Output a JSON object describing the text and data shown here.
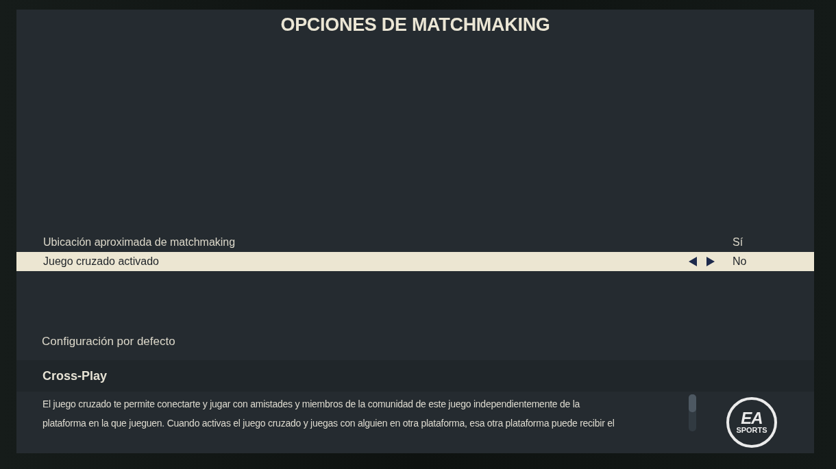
{
  "title": "OPCIONES DE MATCHMAKING",
  "settings": [
    {
      "label": "Ubicación aproximada de matchmaking",
      "value": "Sí",
      "selected": false
    },
    {
      "label": "Juego cruzado activado",
      "value": "No",
      "selected": true
    }
  ],
  "reset_button": {
    "label": "Configuración por defecto"
  },
  "help": {
    "title": "Cross-Play",
    "lines": [
      "El juego cruzado te permite conectarte y jugar con amistades y miembros de la comunidad de este juego independientemente de la",
      "plataforma en la que jueguen. Cuando activas el juego cruzado y juegas con alguien en otra plataforma, esa otra plataforma puede recibir el"
    ]
  },
  "logo": {
    "top": "EA",
    "bottom": "SPORTS"
  }
}
